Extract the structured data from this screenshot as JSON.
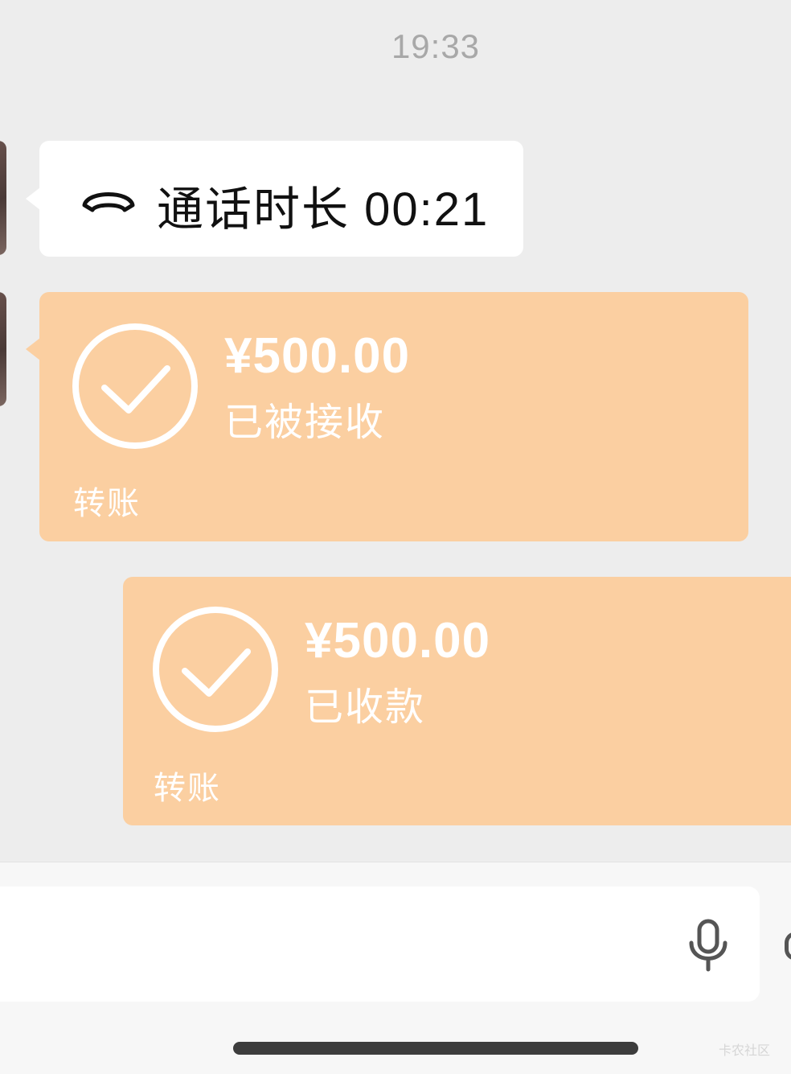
{
  "header": {
    "time": "19:33"
  },
  "messages": {
    "call": {
      "icon": "phone-hangup-icon",
      "text": "通话时长 00:21"
    },
    "received_transfer": {
      "icon": "check-circle-icon",
      "amount": "¥500.00",
      "status": "已被接收",
      "label": "转账"
    },
    "sent_transfer": {
      "icon": "check-circle-icon",
      "amount": "¥500.00",
      "status": "已收款",
      "label": "转账"
    }
  },
  "input_bar": {
    "value": "",
    "mic_icon": "microphone-icon"
  },
  "watermark": "卡农社区",
  "colors": {
    "background": "#ededed",
    "transfer_bubble": "#fbcfa1",
    "white_bubble": "#ffffff"
  }
}
